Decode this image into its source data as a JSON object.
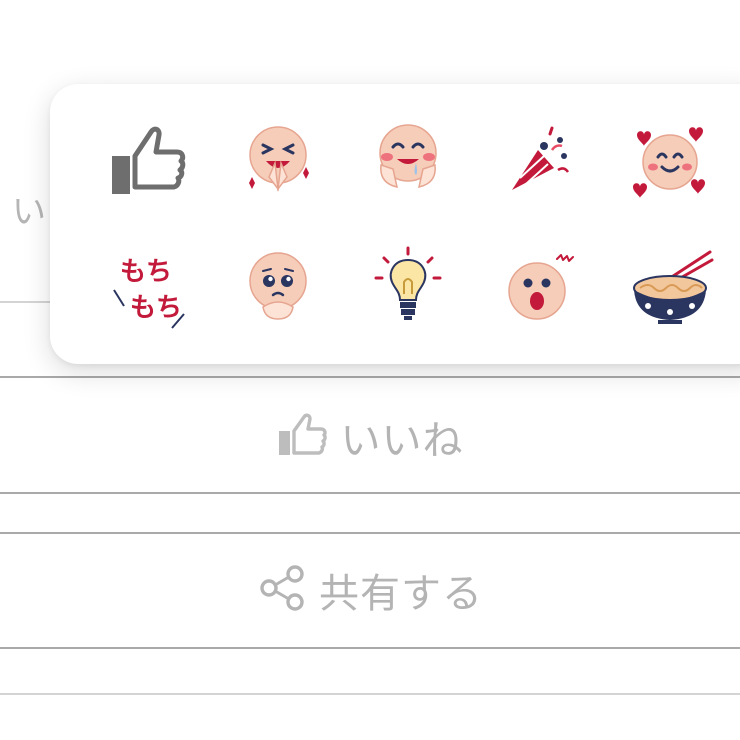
{
  "background_partial_text": "い",
  "actions": {
    "like_label": "いいね",
    "share_label": "共有する"
  },
  "reaction_picker": {
    "items": [
      {
        "name": "thumbs-up-icon"
      },
      {
        "name": "laughing-clap-sticker"
      },
      {
        "name": "drooling-face-sticker"
      },
      {
        "name": "party-popper-sticker"
      },
      {
        "name": "hearts-smile-sticker"
      },
      {
        "name": "mochimochi-sticker",
        "text_top": "もち",
        "text_bottom": "もち"
      },
      {
        "name": "pleading-face-sticker"
      },
      {
        "name": "lightbulb-sticker"
      },
      {
        "name": "surprised-face-sticker"
      },
      {
        "name": "ramen-bowl-sticker"
      }
    ]
  },
  "colors": {
    "icon_gray": "#6e6e6e",
    "label_gray": "#b4b4b4",
    "sticker_red": "#c3193a",
    "skin": "#f6cdb9",
    "navy": "#2a3560"
  }
}
